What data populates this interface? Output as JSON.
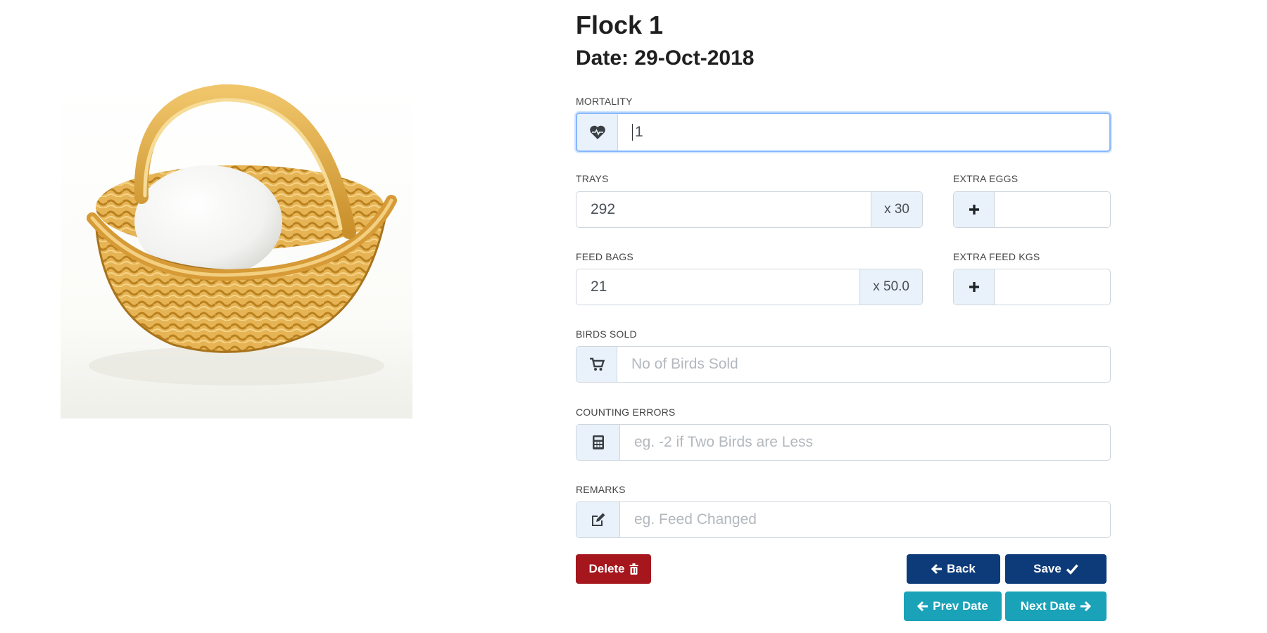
{
  "page": {
    "title": "Flock 1",
    "date_prefix": "Date:",
    "date_value": "29-Oct-2018"
  },
  "fields": {
    "mortality": {
      "label": "MORTALITY",
      "value": "1",
      "icon": "heartbeat-icon"
    },
    "trays": {
      "label": "TRAYS",
      "value": "292",
      "suffix": "x 30"
    },
    "extra_eggs": {
      "label": "EXTRA EGGS",
      "value": "",
      "icon": "plus-icon"
    },
    "feed_bags": {
      "label": "FEED BAGS",
      "value": "21",
      "suffix": "x 50.0"
    },
    "extra_feed_kgs": {
      "label": "EXTRA FEED KGS",
      "value": "",
      "icon": "plus-icon"
    },
    "birds_sold": {
      "label": "BIRDS SOLD",
      "value": "",
      "placeholder": "No of Birds Sold",
      "icon": "cart-icon"
    },
    "counting_errors": {
      "label": "COUNTING ERRORS",
      "value": "",
      "placeholder": "eg. -2 if Two Birds are Less",
      "icon": "calculator-icon"
    },
    "remarks": {
      "label": "REMARKS",
      "value": "",
      "placeholder": "eg. Feed Changed",
      "icon": "edit-icon"
    }
  },
  "buttons": {
    "delete": "Delete",
    "back": "Back",
    "save": "Save",
    "prev_date": "Prev Date",
    "next_date": "Next Date"
  },
  "colors": {
    "danger": "#a5161d",
    "primary": "#0d3a78",
    "info": "#1aa2b8",
    "focus_border": "#86b7fe",
    "addon_bg": "#e9f2fb"
  },
  "image": {
    "subject": "egg-in-wicker-basket"
  }
}
